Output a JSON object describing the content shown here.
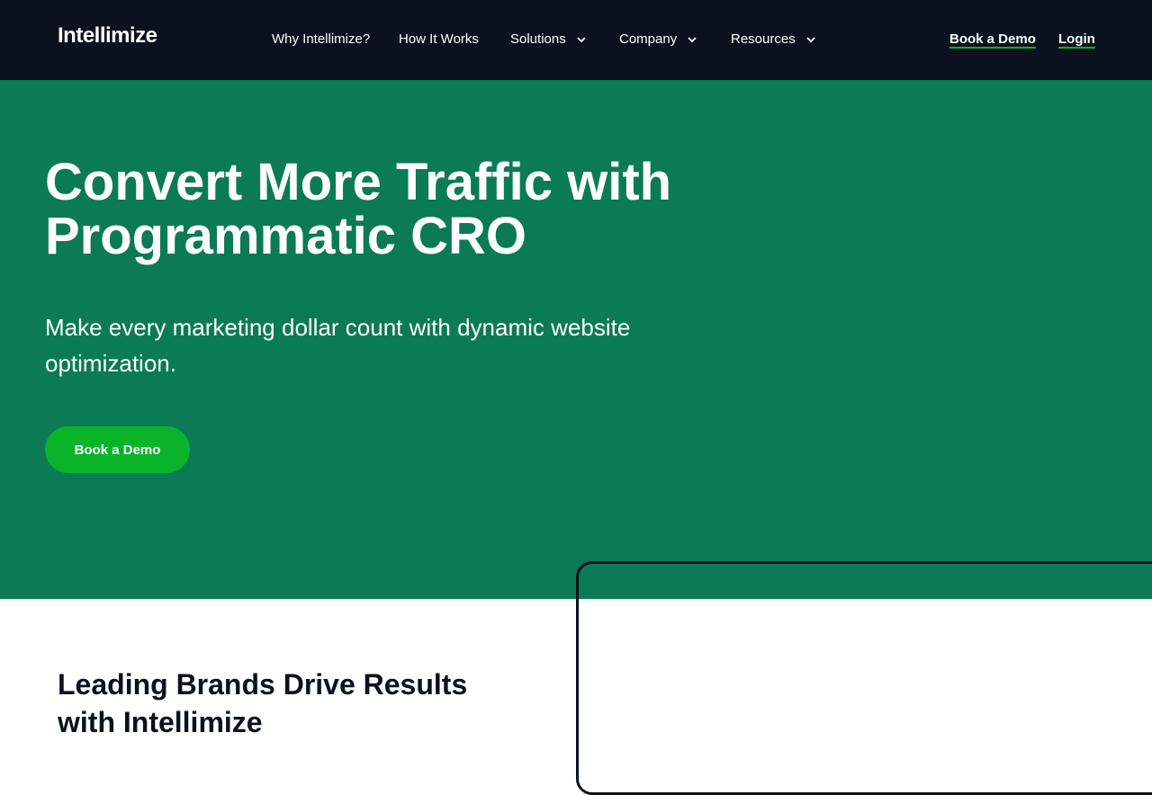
{
  "nav": {
    "logo": "Intellimize",
    "items": [
      {
        "label": "Why Intellimize?",
        "dropdown": false
      },
      {
        "label": "How It Works",
        "dropdown": false
      },
      {
        "label": "Solutions",
        "dropdown": true
      },
      {
        "label": "Company",
        "dropdown": true
      },
      {
        "label": "Resources",
        "dropdown": true
      }
    ],
    "book_demo": "Book a Demo",
    "login": "Login"
  },
  "hero": {
    "title": "Convert More Traffic with Programmatic CRO",
    "subtitle": "Make every marketing dollar count with dynamic website optimization.",
    "cta": "Book a Demo"
  },
  "brands": {
    "title": "Leading Brands Drive Results with Intellimize"
  },
  "colors": {
    "nav_bg": "#0b111e",
    "hero_bg": "#0a7b55",
    "accent_green": "#0ab42a"
  },
  "icons": {
    "dropdown": "chevron-down-icon"
  }
}
